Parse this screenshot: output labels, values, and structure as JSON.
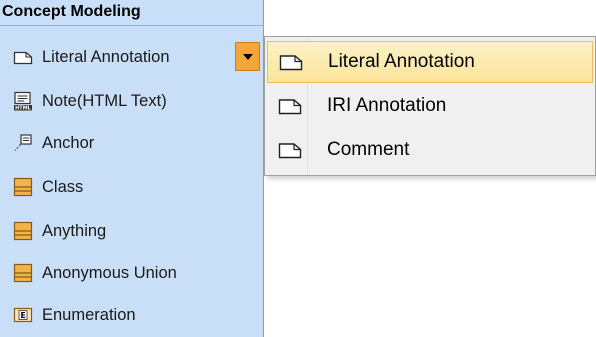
{
  "palette": {
    "header_bold": "Concept Modeling",
    "items": [
      {
        "label": "Literal Annotation",
        "icon": "annotation-icon"
      },
      {
        "label": "Note(HTML Text)",
        "icon": "html-note-icon"
      },
      {
        "label": "Anchor",
        "icon": "anchor-icon"
      },
      {
        "label": "Class",
        "icon": "class-icon"
      },
      {
        "label": "Anything",
        "icon": "class-icon"
      },
      {
        "label": "Anonymous Union",
        "icon": "class-icon"
      },
      {
        "label": "Enumeration",
        "icon": "enumeration-icon"
      }
    ]
  },
  "menu": {
    "items": [
      {
        "label": "Literal Annotation",
        "icon": "annotation-icon",
        "selected": true
      },
      {
        "label": "IRI Annotation",
        "icon": "annotation-icon",
        "selected": false
      },
      {
        "label": "Comment",
        "icon": "annotation-icon",
        "selected": false
      }
    ]
  },
  "colors": {
    "palette_bg": "#c9dff7",
    "menu_bg": "#f0f0f0",
    "highlight": "#fbe49a",
    "dropdown_button": "#f5a637",
    "class_icon": "#f2b349"
  }
}
